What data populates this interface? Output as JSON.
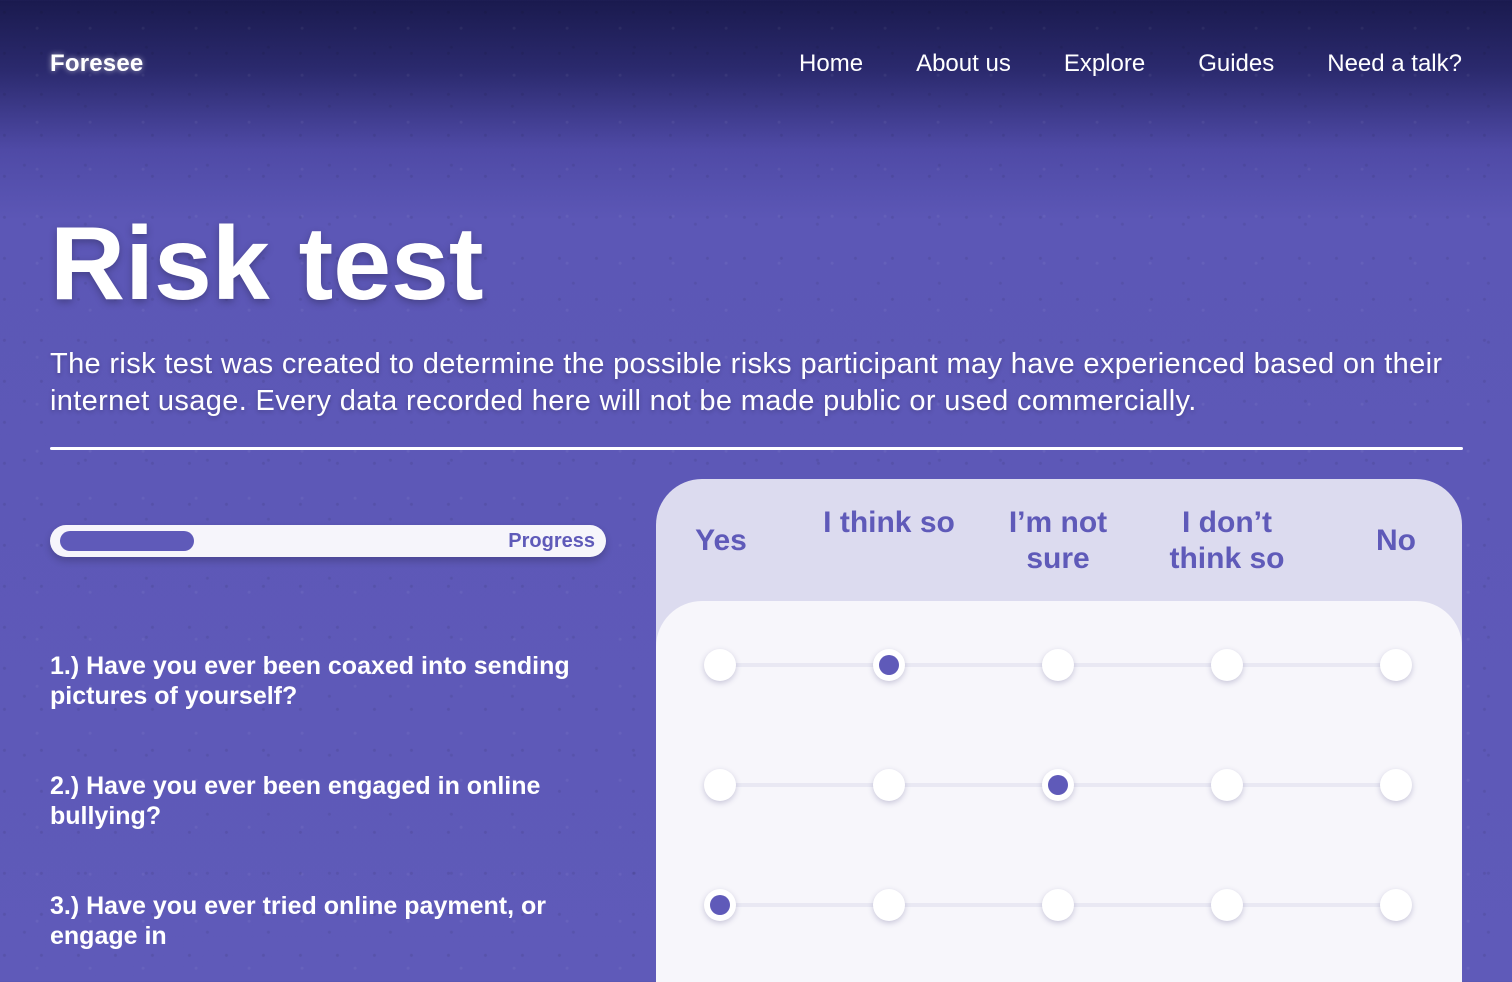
{
  "nav": {
    "logo": "Foresee",
    "links": [
      "Home",
      "About us",
      "Explore",
      "Guides",
      "Need a talk?"
    ]
  },
  "hero": {
    "title": "Risk test",
    "description": "The risk test was created to determine the possible risks participant may have experienced based on their internet usage. Every data recorded here will not be made public or used commercially."
  },
  "progress": {
    "label": "Progress",
    "value": 0.25
  },
  "scale": {
    "options": [
      "Yes",
      "I think so",
      "I’m not sure",
      "I don’t think so",
      "No"
    ]
  },
  "questions": [
    {
      "text": "1.) Have you ever been coaxed into sending pictures of yourself?",
      "selected": "I think so"
    },
    {
      "text": "2.) Have you ever been engaged in online bullying?",
      "selected": "I’m not sure"
    },
    {
      "text": "3.) Have you ever tried online payment,  or engage in",
      "selected": "Yes"
    }
  ],
  "colors": {
    "accent": "#5f5ab9",
    "panel_header": "#dcdbef",
    "panel_body": "#f7f6fb"
  }
}
